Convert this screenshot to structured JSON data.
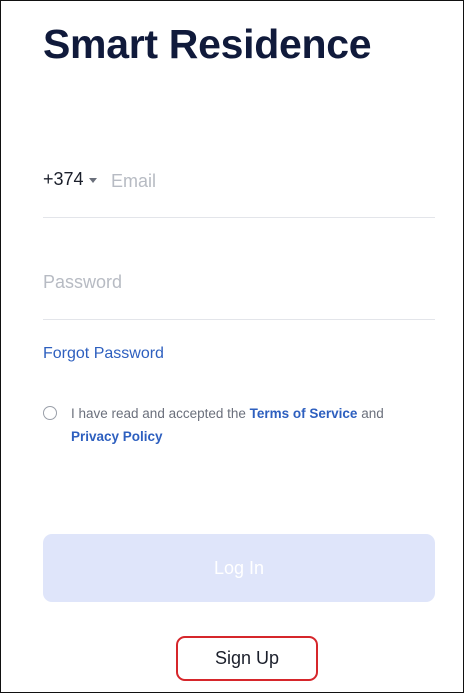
{
  "app": {
    "title": "Smart Residence"
  },
  "login": {
    "country_code": "+374",
    "country_code_icon": "caret-down-icon",
    "email": {
      "placeholder": "Email",
      "value": ""
    },
    "password": {
      "placeholder": "Password",
      "value": ""
    },
    "forgot_password_label": "Forgot Password",
    "consent": {
      "checked": false,
      "text_before": "I have read and accepted the ",
      "terms_label": "Terms of Service",
      "text_between": " and ",
      "privacy_label": "Privacy Policy"
    },
    "login_button_label": "Log In",
    "signup_button_label": "Sign Up"
  },
  "colors": {
    "title": "#101a3b",
    "link": "#2d5fbf",
    "login_button_bg": "#dfe5fa",
    "signup_highlight_border": "#d6262b",
    "divider": "#e3e5ea"
  }
}
